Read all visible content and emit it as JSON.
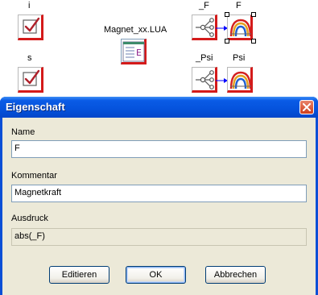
{
  "canvas": {
    "blocks": {
      "i": {
        "label": "i",
        "icon": "checkbox-input-icon"
      },
      "s": {
        "label": "s",
        "icon": "checkbox-input-icon"
      },
      "file": {
        "label": "Magnet_xx.LUA",
        "icon": "lua-script-file-icon"
      },
      "f_src": {
        "label": "_F",
        "icon": "branch-network-icon"
      },
      "f_dst": {
        "label": "F",
        "icon": "rainbow-arc-icon",
        "selected": true
      },
      "psi_src": {
        "label": "_Psi",
        "icon": "branch-network-icon"
      },
      "psi_dst": {
        "label": "Psi",
        "icon": "rainbow-arc-icon"
      }
    },
    "colors": {
      "accent_red": "#d41a1a",
      "arrow_blue": "#0000ff"
    }
  },
  "dialog": {
    "title": "Eigenschaft",
    "name_label": "Name",
    "name_value": "F",
    "comment_label": "Kommentar",
    "comment_value": "Magnetkraft",
    "expression_label": "Ausdruck",
    "expression_value": "abs(_F)",
    "buttons": {
      "edit": "Editieren",
      "ok": "OK",
      "cancel": "Abbrechen"
    },
    "colors": {
      "titlebar": "#0552dc",
      "client": "#ece9d8"
    }
  }
}
